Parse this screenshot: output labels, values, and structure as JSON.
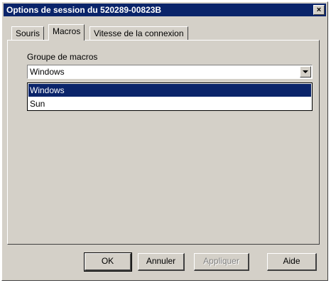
{
  "window": {
    "title": "Options de session du 520289-00823B",
    "close_label": "×"
  },
  "tabs": [
    {
      "label": "Souris"
    },
    {
      "label": "Macros"
    },
    {
      "label": "Vitesse de la connexion"
    }
  ],
  "macros": {
    "group_label": "Groupe de macros",
    "selected": "Windows",
    "options": [
      "Windows",
      "Sun"
    ]
  },
  "buttons": {
    "ok": "OK",
    "cancel": "Annuler",
    "apply": "Appliquer",
    "help": "Aide"
  },
  "colors": {
    "titlebar": "#0a246a",
    "face": "#d4d0c8",
    "selection": "#0a246a"
  }
}
